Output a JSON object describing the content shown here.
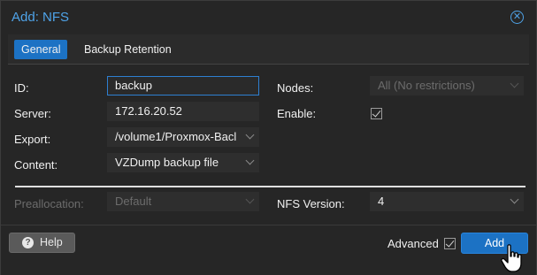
{
  "dialog": {
    "title": "Add: NFS",
    "close_icon": "close-circle-icon"
  },
  "tabs": [
    {
      "label": "General",
      "active": true
    },
    {
      "label": "Backup Retention",
      "active": false
    }
  ],
  "form": {
    "id": {
      "label": "ID:",
      "value": "backup"
    },
    "server": {
      "label": "Server:",
      "value": "172.16.20.52"
    },
    "export": {
      "label": "Export:",
      "value": "/volume1/Proxmox-Bacl"
    },
    "content": {
      "label": "Content:",
      "value": "VZDump backup file"
    },
    "nodes": {
      "label": "Nodes:",
      "value": "All (No restrictions)"
    },
    "enable": {
      "label": "Enable:",
      "checked": true
    },
    "preallocation": {
      "label": "Preallocation:",
      "value": "Default"
    },
    "nfs_version": {
      "label": "NFS Version:",
      "value": "4"
    }
  },
  "footer": {
    "help_label": "Help",
    "help_icon": "question-circle-icon",
    "advanced_label": "Advanced",
    "advanced_checked": true,
    "add_label": "Add"
  },
  "colors": {
    "accent": "#1c72c4",
    "title": "#4fa3e8",
    "background": "#262626"
  }
}
